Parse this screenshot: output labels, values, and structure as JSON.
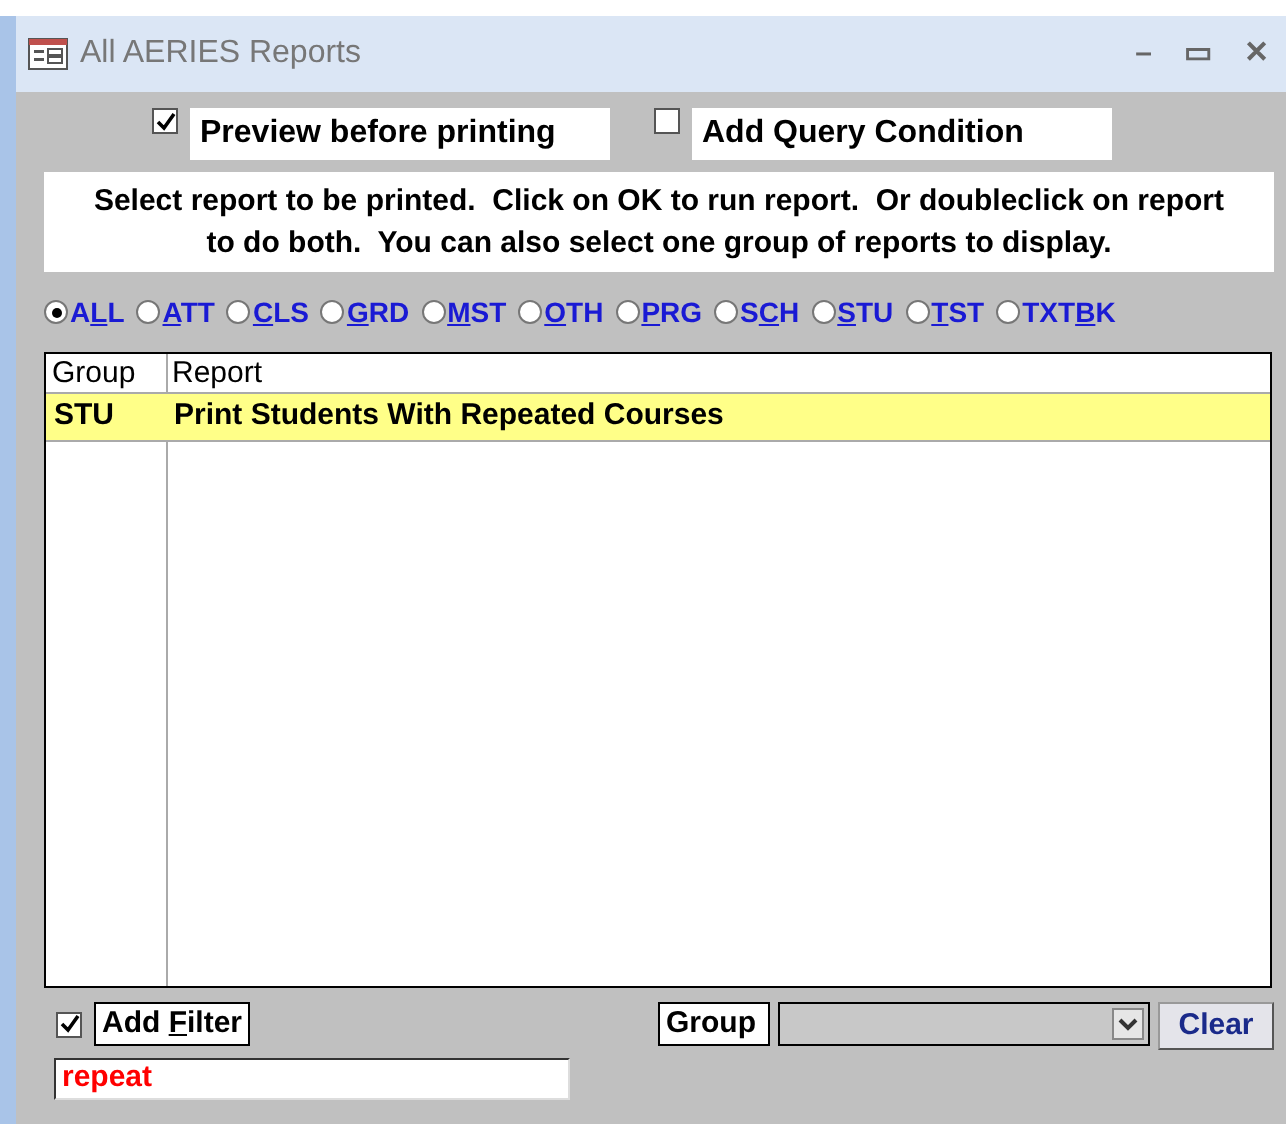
{
  "window": {
    "title": "All AERIES Reports",
    "controls": [
      "–",
      "▭",
      "✕"
    ]
  },
  "options": [
    {
      "label": "Preview before printing",
      "checked": true
    },
    {
      "label": "Add Query Condition",
      "checked": false
    }
  ],
  "instructions": "Select report to be printed.  Click on OK to run report.  Or doubleclick on report  to do both.  You can also select one group of reports to display.",
  "groups": [
    {
      "before": "A",
      "key": "L",
      "after": "L",
      "selected": true
    },
    {
      "key": "A",
      "after": "TT",
      "selected": false
    },
    {
      "key": "C",
      "after": "LS",
      "selected": false
    },
    {
      "key": "G",
      "after": "RD",
      "selected": false
    },
    {
      "key": "M",
      "after": "ST",
      "selected": false
    },
    {
      "key": "O",
      "after": "TH",
      "selected": false
    },
    {
      "key": "P",
      "after": "RG",
      "selected": false
    },
    {
      "before": "S",
      "key": "C",
      "after": "H",
      "selected": false
    },
    {
      "key": "S",
      "after": "TU",
      "selected": false
    },
    {
      "key": "T",
      "after": "ST",
      "selected": false
    },
    {
      "before": "TXT",
      "key": "B",
      "after": "K",
      "selected": false
    }
  ],
  "table": {
    "columns": [
      "Group",
      "Report"
    ],
    "rows": [
      {
        "group": "STU",
        "report": "Print Students With Repeated Courses",
        "selected": true
      }
    ]
  },
  "filter": {
    "checked": true,
    "before": "Add ",
    "key": "F",
    "after": "ilter",
    "value": "repeat"
  },
  "group_filter": {
    "label": "Group",
    "button": "Clear"
  }
}
